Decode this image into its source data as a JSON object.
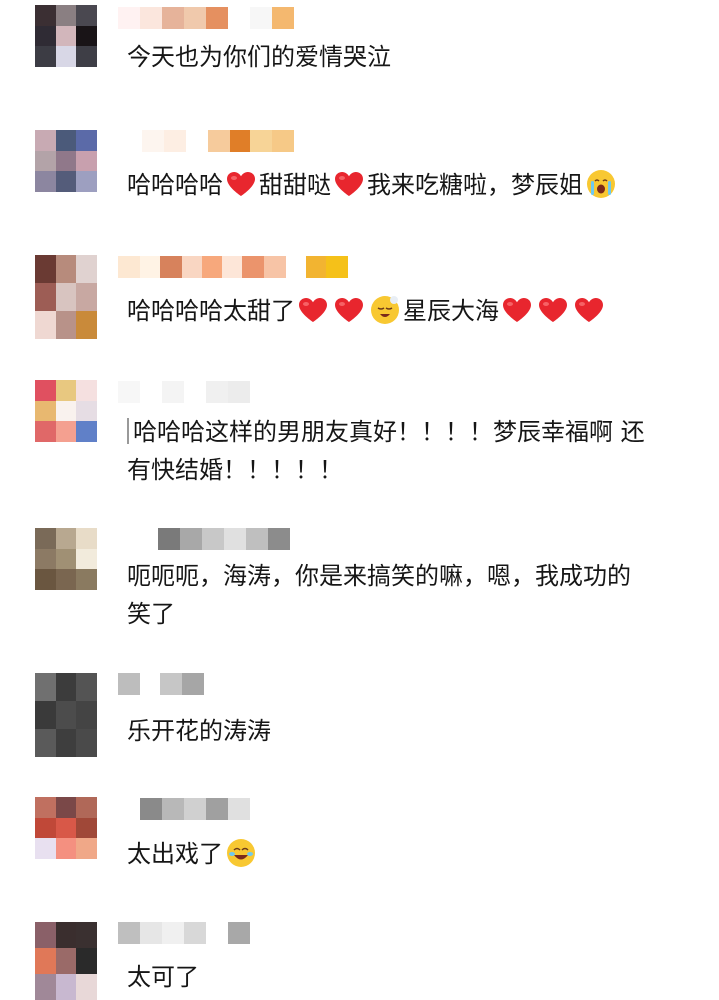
{
  "comments": [
    {
      "text": [
        "今天也为你们的爱情哭泣"
      ],
      "avatar": [
        "#3b2f33",
        "#8a7f82",
        "#4a4850",
        "#2f2b34",
        "#d2b6bb",
        "#191417",
        "#3c3c44",
        "#d8d7e6",
        "#3e3e46"
      ],
      "username_blocks": [
        "#fff2f2",
        "#fbe6dd",
        "#e6b39a",
        "#f0c9ac",
        "#e59060",
        "#ffffff",
        "#f7f7f7",
        "#f4b86f"
      ]
    },
    {
      "segments": [
        {
          "t": "text",
          "v": "哈哈哈哈"
        },
        {
          "t": "icon",
          "icon": "heart-icon"
        },
        {
          "t": "text",
          "v": "甜甜哒"
        },
        {
          "t": "icon",
          "icon": "heart-icon"
        },
        {
          "t": "text",
          "v": "我来吃糖啦，梦辰姐"
        },
        {
          "t": "icon",
          "icon": "crying-face-icon"
        }
      ],
      "avatar": [
        "#c8aab3",
        "#4b5a7a",
        "#5b6aa8",
        "#b3a3a8",
        "#90788a",
        "#c8a0ae",
        "#8c86a0",
        "#545c7a",
        "#9d9fc0"
      ],
      "username_blocks": [
        "#ffffff",
        "#fdf5ef",
        "#fdeee3",
        "#ffffff",
        "#f6cb9c",
        "#e07e28",
        "#f7d497",
        "#f6c987"
      ]
    },
    {
      "segments": [
        {
          "t": "text",
          "v": "哈哈哈哈太甜了"
        },
        {
          "t": "icon",
          "icon": "heart-icon"
        },
        {
          "t": "icon",
          "icon": "heart-icon"
        },
        {
          "t": "icon",
          "icon": "sleepy-face-icon"
        },
        {
          "t": "text",
          "v": "星辰大海"
        },
        {
          "t": "icon",
          "icon": "heart-icon"
        },
        {
          "t": "icon",
          "icon": "heart-icon"
        },
        {
          "t": "icon",
          "icon": "heart-icon"
        }
      ],
      "avatar": [
        "#6a3a33",
        "#b78b7c",
        "#e0d2d0",
        "#9d5d55",
        "#d8c4c0",
        "#c8a8a2",
        "#efd8d2",
        "#b89289",
        "#c98a3a"
      ],
      "username_blocks": [
        "#fde8d2",
        "#fff3e5",
        "#d7825c",
        "#f9d6c2",
        "#f7a87c",
        "#fde6d8",
        "#eb946c",
        "#f7c4a6",
        "#ffffff",
        "#f2b431",
        "#f5c119"
      ]
    },
    {
      "text": [
        "哈哈哈这样的男朋友真好！！！！梦辰幸福啊 还",
        "有快结婚！！！！！"
      ],
      "avatar": [
        "#e05060",
        "#e8c880",
        "#f5e0e0",
        "#e8b870",
        "#f9f2ee",
        "#e6dde4",
        "#e06868",
        "#f4a090",
        "#6080c8"
      ],
      "username_blocks": [
        "#f7f7f7",
        "#ffffff",
        "#f4f4f4",
        "#ffffff",
        "#f0f0f0",
        "#ececec"
      ]
    },
    {
      "text": [
        "呃呃呃，海涛，你是来搞笑的嘛，嗯，我成功的",
        "笑了"
      ],
      "avatar": [
        "#7a6a58",
        "#b8a890",
        "#e8dcc8",
        "#8c7a64",
        "#a09074",
        "#f2ebdc",
        "#6a5640",
        "#7a6650",
        "#8a7a60"
      ],
      "username_blocks": [
        "#7a7a7a",
        "#a8a8a8",
        "#c8c8c8",
        "#e0e0e0",
        "#bfbfbf",
        "#8c8c8c"
      ]
    },
    {
      "text": [
        "乐开花的涛涛"
      ],
      "avatar": [
        "#707070",
        "#3c3c3c",
        "#545454",
        "#3a3a3a",
        "#4c4c4c",
        "#444444",
        "#5a5a5a",
        "#3e3e3e",
        "#4a4a4a"
      ],
      "username_blocks": [
        "#bdbdbd",
        "#ffffff",
        "#c6c6c6",
        "#a6a6a6"
      ]
    },
    {
      "segments": [
        {
          "t": "text",
          "v": "太出戏了"
        },
        {
          "t": "icon",
          "icon": "tears-of-joy-face-icon"
        }
      ],
      "avatar": [
        "#c07060",
        "#7a4848",
        "#b06858",
        "#c04838",
        "#d85848",
        "#a04838",
        "#e8e0f0",
        "#f49080",
        "#f0a888"
      ],
      "username_blocks": [
        "#8a8a8a",
        "#b8b8b8",
        "#d0d0d0",
        "#a0a0a0",
        "#e0e0e0"
      ]
    },
    {
      "text": [
        "太可了"
      ],
      "avatar": [
        "#8a6068",
        "#3a2e2e",
        "#3a3030",
        "#e07858",
        "#9a6a68",
        "#2a2a2a",
        "#a08898",
        "#c8b8d0",
        "#e8d8d8"
      ],
      "username_blocks": [
        "#bfbfbf",
        "#e6e6e6",
        "#f0f0f0",
        "#d8d8d8",
        "#ffffff",
        "#a8a8a8"
      ]
    }
  ],
  "colors": {
    "heart": "#e8262e",
    "emoji_face": "#f8c832",
    "text": "#161616"
  }
}
